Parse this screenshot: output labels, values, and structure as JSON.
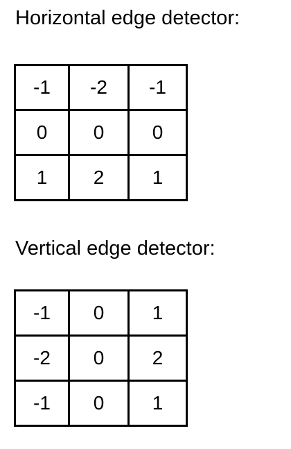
{
  "horizontal": {
    "title": "Horizontal edge detector:",
    "rows": [
      [
        "-1",
        "-2",
        "-1"
      ],
      [
        "0",
        "0",
        "0"
      ],
      [
        "1",
        "2",
        "1"
      ]
    ]
  },
  "vertical": {
    "title": "Vertical edge detector:",
    "rows": [
      [
        "-1",
        "0",
        "1"
      ],
      [
        "-2",
        "0",
        "2"
      ],
      [
        "-1",
        "0",
        "1"
      ]
    ]
  }
}
